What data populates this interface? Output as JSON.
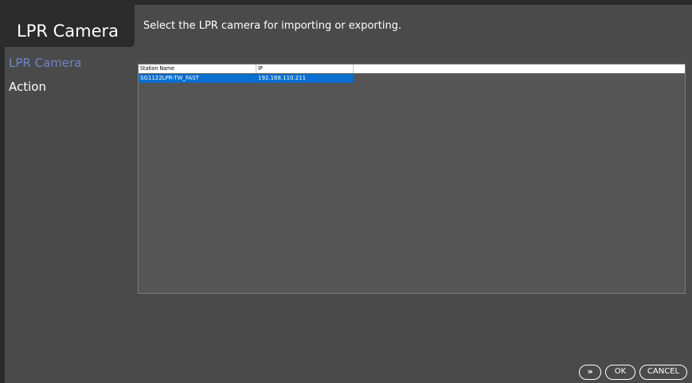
{
  "header": {
    "title": "LPR Camera",
    "description": "Select the LPR  camera for importing or exporting."
  },
  "sidebar": {
    "items": [
      {
        "label": "LPR Camera",
        "active": true
      },
      {
        "label": "Action",
        "active": false
      }
    ]
  },
  "table": {
    "columns": [
      "Station Name",
      "IP"
    ],
    "rows": [
      {
        "station_name": "SG1122LPR-TW_FAST",
        "ip": "192.168.110.211",
        "selected": true
      }
    ]
  },
  "footer": {
    "next_label": "»",
    "ok_label": "OK",
    "cancel_label": "CANCEL"
  },
  "colors": {
    "background": "#4a4a4a",
    "selection": "#0a6fd0",
    "active_nav": "#6f86c8"
  }
}
